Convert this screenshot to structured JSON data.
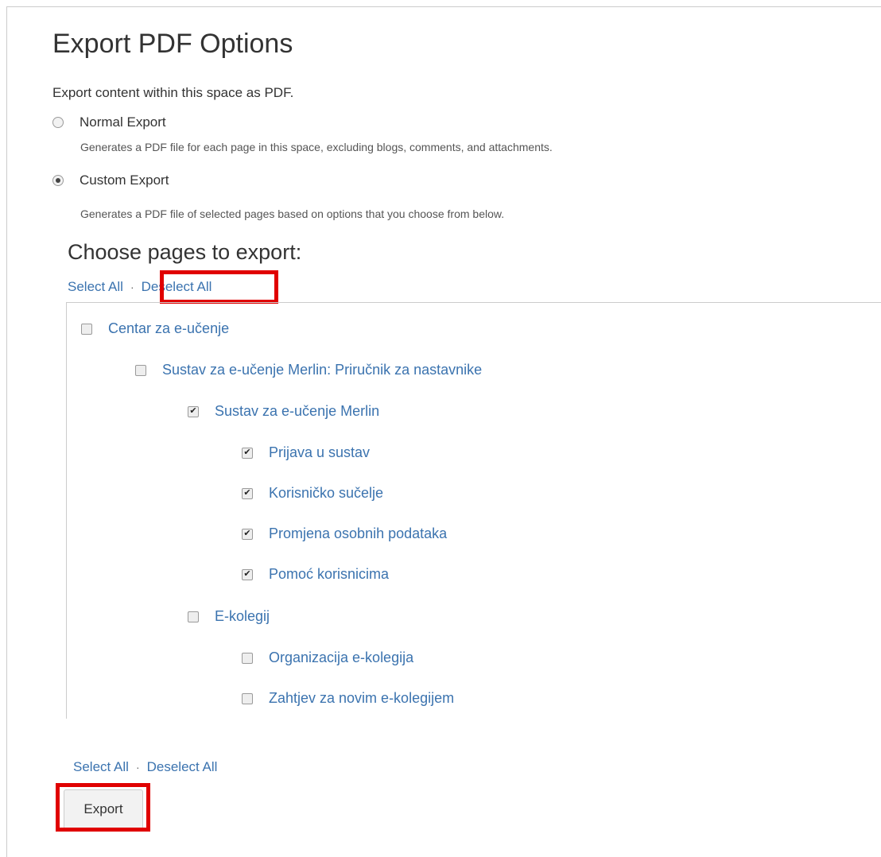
{
  "title": "Export PDF Options",
  "intro": "Export content within this space as PDF.",
  "normal_export": {
    "label": "Normal Export",
    "description": "Generates a PDF file for each page in this space, excluding blogs, comments, and attachments.",
    "selected": false
  },
  "custom_export": {
    "label": "Custom Export",
    "description": "Generates a PDF file of selected pages based on options that you choose from below.",
    "selected": true
  },
  "choose_heading": "Choose pages to export:",
  "links": {
    "select_all": "Select All",
    "deselect_all": "Deselect All",
    "separator": "·"
  },
  "tree": [
    {
      "label": "Centar za e-učenje",
      "checked": false
    },
    {
      "label": "Sustav za e-učenje Merlin: Priručnik za nastavnike",
      "checked": false
    },
    {
      "label": "Sustav za e-učenje Merlin",
      "checked": true
    },
    {
      "label": "Prijava u sustav",
      "checked": true
    },
    {
      "label": "Korisničko sučelje",
      "checked": true
    },
    {
      "label": "Promjena osobnih podataka",
      "checked": true
    },
    {
      "label": "Pomoć korisnicima",
      "checked": true
    },
    {
      "label": "E-kolegij",
      "checked": false
    },
    {
      "label": "Organizacija e-kolegija",
      "checked": false
    },
    {
      "label": "Zahtjev za novim e-kolegijem",
      "checked": false
    }
  ],
  "export_button": "Export",
  "colors": {
    "link": "#3b73af",
    "highlight": "#e00000"
  }
}
